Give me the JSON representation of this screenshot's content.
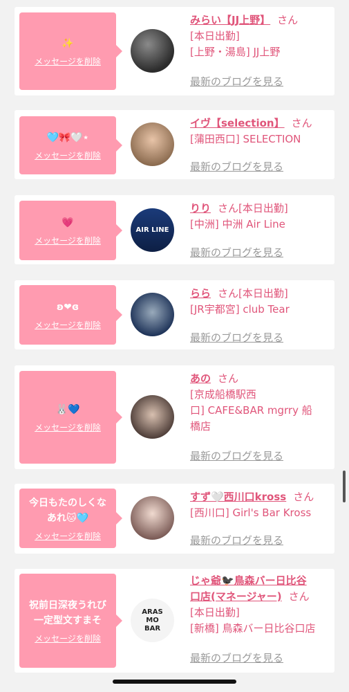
{
  "delete_label": "メッセージを削除",
  "blog_label": "最新のブログを見る",
  "san_label": "さん",
  "colors": {
    "accent": "#ff9bb0",
    "text_pink": "#e0557a",
    "link_gray": "#9a9a9a"
  },
  "cards": [
    {
      "message": "✨",
      "name": "みらい【JJ上野】",
      "lines": [
        "[本日出勤]",
        "[上野・湯島] JJ上野"
      ]
    },
    {
      "message": "🩵🎀🤍⋆",
      "name": "イヴ【selection】",
      "lines": [
        "[蒲田西口] SELECTION"
      ]
    },
    {
      "message": "💗",
      "name": "りり",
      "san_suffix": "[本日出勤]",
      "lines": [
        "[中洲] 中洲 Air Line"
      ],
      "avatar_text": "AIR LINE"
    },
    {
      "message": "ʚ❤︎ɞ",
      "name": "らら",
      "san_suffix": "[本日出勤]",
      "lines": [
        "[JR宇都宮] club Tear"
      ]
    },
    {
      "message": "🐰💙",
      "name": "あの",
      "lines": [
        "[京成船橋駅西",
        "口] CAFE&BAR mgrry 船",
        "橋店"
      ]
    },
    {
      "message": "今日もたのしくな\nあれ🐱🩵",
      "name": "すず🤍西川口kross",
      "lines": [
        "[西川口] Girl's Bar Kross"
      ]
    },
    {
      "message": "祝前日深夜うれび\n一定型文すまそ",
      "name": "じゃ爺🐦‍⬛鳥森バー日比谷\n口店(マネージャー)",
      "lines": [
        "[本日出勤]",
        "[新橋] 鳥森バー日比谷口店"
      ],
      "avatar_text": "ARAS\nMO\nBAR"
    }
  ]
}
